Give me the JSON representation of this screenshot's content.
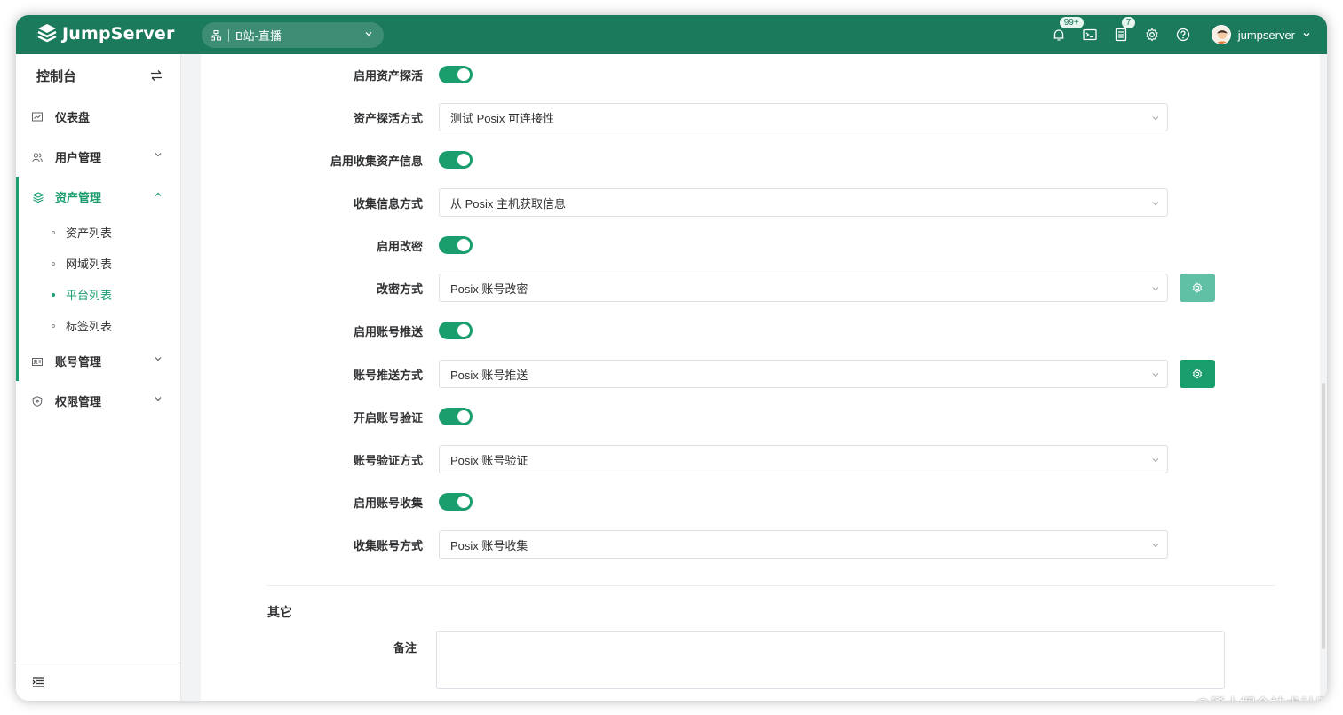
{
  "app": {
    "name": "JumpServer"
  },
  "header": {
    "org_name": "B站-直播",
    "notifications_badge": "99+",
    "tickets_badge": "7",
    "username": "jumpserver"
  },
  "sidebar": {
    "title": "控制台",
    "items": [
      {
        "label": "仪表盘",
        "icon": "dashboard-icon"
      },
      {
        "label": "用户管理",
        "icon": "users-icon"
      },
      {
        "label": "资产管理",
        "icon": "assets-icon"
      },
      {
        "label": "账号管理",
        "icon": "accounts-icon"
      },
      {
        "label": "权限管理",
        "icon": "permissions-icon"
      }
    ],
    "asset_sub_items": [
      {
        "label": "资产列表",
        "active": false
      },
      {
        "label": "网域列表",
        "active": false
      },
      {
        "label": "平台列表",
        "active": true
      },
      {
        "label": "标签列表",
        "active": false
      }
    ]
  },
  "form": {
    "rows": [
      {
        "label": "启用资产探活",
        "type": "switch",
        "on": true
      },
      {
        "label": "资产探活方式",
        "type": "select",
        "value": "测试 Posix 可连接性"
      },
      {
        "label": "启用收集资产信息",
        "type": "switch",
        "on": true
      },
      {
        "label": "收集信息方式",
        "type": "select",
        "value": "从 Posix 主机获取信息"
      },
      {
        "label": "启用改密",
        "type": "switch",
        "on": true
      },
      {
        "label": "改密方式",
        "type": "select",
        "value": "Posix 账号改密"
      },
      {
        "label": "启用账号推送",
        "type": "switch",
        "on": true
      },
      {
        "label": "账号推送方式",
        "type": "select",
        "value": "Posix 账号推送"
      },
      {
        "label": "开启账号验证",
        "type": "switch",
        "on": true
      },
      {
        "label": "账号验证方式",
        "type": "select",
        "value": "Posix 账号验证"
      },
      {
        "label": "启用账号收集",
        "type": "switch",
        "on": true
      },
      {
        "label": "收集账号方式",
        "type": "select",
        "value": "Posix 账号收集"
      }
    ],
    "other_section_title": "其它",
    "note_label": "备注"
  },
  "colors": {
    "brand": "#1b7a5c",
    "accent": "#1b9e6e"
  },
  "watermark": "@稀土掘金技术社区"
}
